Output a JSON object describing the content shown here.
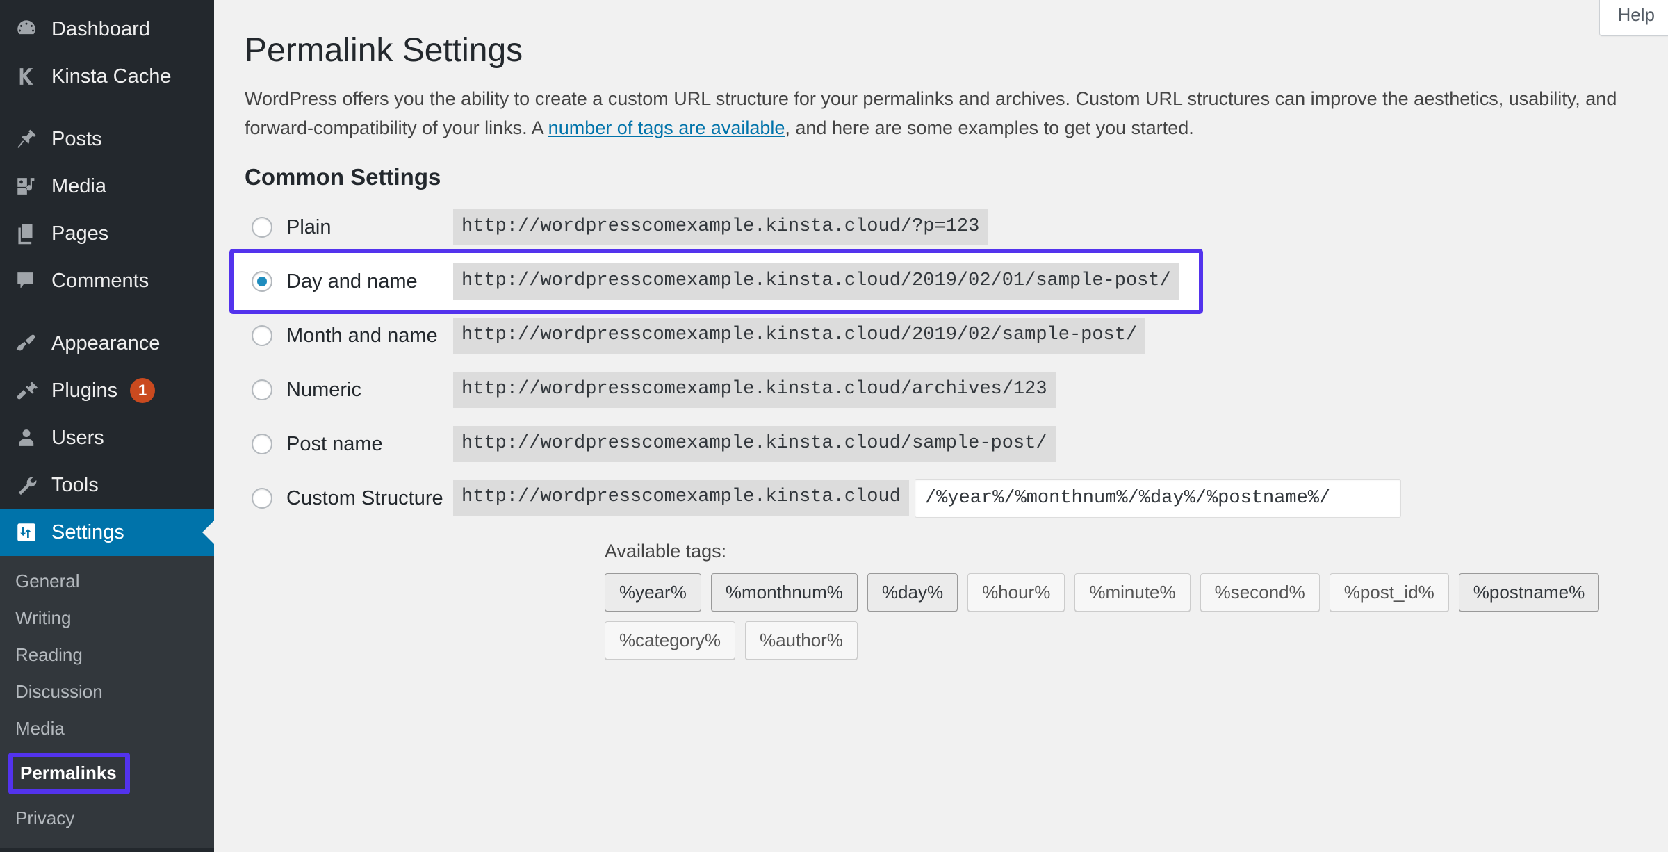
{
  "sidebar": {
    "items": [
      {
        "label": "Dashboard",
        "icon": "dashboard-icon",
        "name": "dashboard",
        "gap": false,
        "current": false,
        "badge": null
      },
      {
        "label": "Kinsta Cache",
        "icon": "kinsta-k-icon",
        "name": "kinsta-cache",
        "gap": true,
        "current": false,
        "badge": null
      },
      {
        "label": "Posts",
        "icon": "pin-icon",
        "name": "posts",
        "gap": false,
        "current": false,
        "badge": null
      },
      {
        "label": "Media",
        "icon": "media-icon",
        "name": "media",
        "gap": false,
        "current": false,
        "badge": null
      },
      {
        "label": "Pages",
        "icon": "pages-icon",
        "name": "pages",
        "gap": false,
        "current": false,
        "badge": null
      },
      {
        "label": "Comments",
        "icon": "comment-icon",
        "name": "comments",
        "gap": true,
        "current": false,
        "badge": null
      },
      {
        "label": "Appearance",
        "icon": "paintbrush-icon",
        "name": "appearance",
        "gap": false,
        "current": false,
        "badge": null
      },
      {
        "label": "Plugins",
        "icon": "plug-icon",
        "name": "plugins",
        "gap": false,
        "current": false,
        "badge": "1"
      },
      {
        "label": "Users",
        "icon": "user-icon",
        "name": "users",
        "gap": false,
        "current": false,
        "badge": null
      },
      {
        "label": "Tools",
        "icon": "wrench-icon",
        "name": "tools",
        "gap": false,
        "current": false,
        "badge": null
      },
      {
        "label": "Settings",
        "icon": "settings-sliders-icon",
        "name": "settings",
        "gap": false,
        "current": true,
        "badge": null
      }
    ],
    "submenu": [
      {
        "label": "General",
        "name": "general",
        "active": false
      },
      {
        "label": "Writing",
        "name": "writing",
        "active": false
      },
      {
        "label": "Reading",
        "name": "reading",
        "active": false
      },
      {
        "label": "Discussion",
        "name": "discussion",
        "active": false
      },
      {
        "label": "Media",
        "name": "media",
        "active": false
      },
      {
        "label": "Permalinks",
        "name": "permalinks",
        "active": true
      },
      {
        "label": "Privacy",
        "name": "privacy",
        "active": false
      }
    ],
    "highlight_color": "#5333ed",
    "current_color": "#0073aa",
    "badge_color": "#ca4a1f"
  },
  "header": {
    "help_tab": "Help",
    "page_title": "Permalink Settings"
  },
  "intro": {
    "part1": "WordPress offers you the ability to create a custom URL structure for your permalinks and archives. Custom URL structures can improve the aesthetics, usability, and forward-compatibility of your links. A ",
    "link_text": "number of tags are available",
    "part2": ", and here are some examples to get you started."
  },
  "common_settings": {
    "title": "Common Settings",
    "options": [
      {
        "label": "Plain",
        "example": "http://wordpresscomexample.kinsta.cloud/?p=123",
        "selected": false,
        "highlighted": false
      },
      {
        "label": "Day and name",
        "example": "http://wordpresscomexample.kinsta.cloud/2019/02/01/sample-post/",
        "selected": true,
        "highlighted": true
      },
      {
        "label": "Month and name",
        "example": "http://wordpresscomexample.kinsta.cloud/2019/02/sample-post/",
        "selected": false,
        "highlighted": false
      },
      {
        "label": "Numeric",
        "example": "http://wordpresscomexample.kinsta.cloud/archives/123",
        "selected": false,
        "highlighted": false
      },
      {
        "label": "Post name",
        "example": "http://wordpresscomexample.kinsta.cloud/sample-post/",
        "selected": false,
        "highlighted": false
      }
    ],
    "custom": {
      "label": "Custom Structure",
      "base_url": "http://wordpresscomexample.kinsta.cloud",
      "value": "/%year%/%monthnum%/%day%/%postname%/",
      "selected": false
    },
    "available_tags_label": "Available tags:",
    "tags": [
      {
        "label": "%year%",
        "used": true
      },
      {
        "label": "%monthnum%",
        "used": true
      },
      {
        "label": "%day%",
        "used": true
      },
      {
        "label": "%hour%",
        "used": false
      },
      {
        "label": "%minute%",
        "used": false
      },
      {
        "label": "%second%",
        "used": false
      },
      {
        "label": "%post_id%",
        "used": false
      },
      {
        "label": "%postname%",
        "used": true
      },
      {
        "label": "%category%",
        "used": false
      },
      {
        "label": "%author%",
        "used": false
      }
    ]
  }
}
